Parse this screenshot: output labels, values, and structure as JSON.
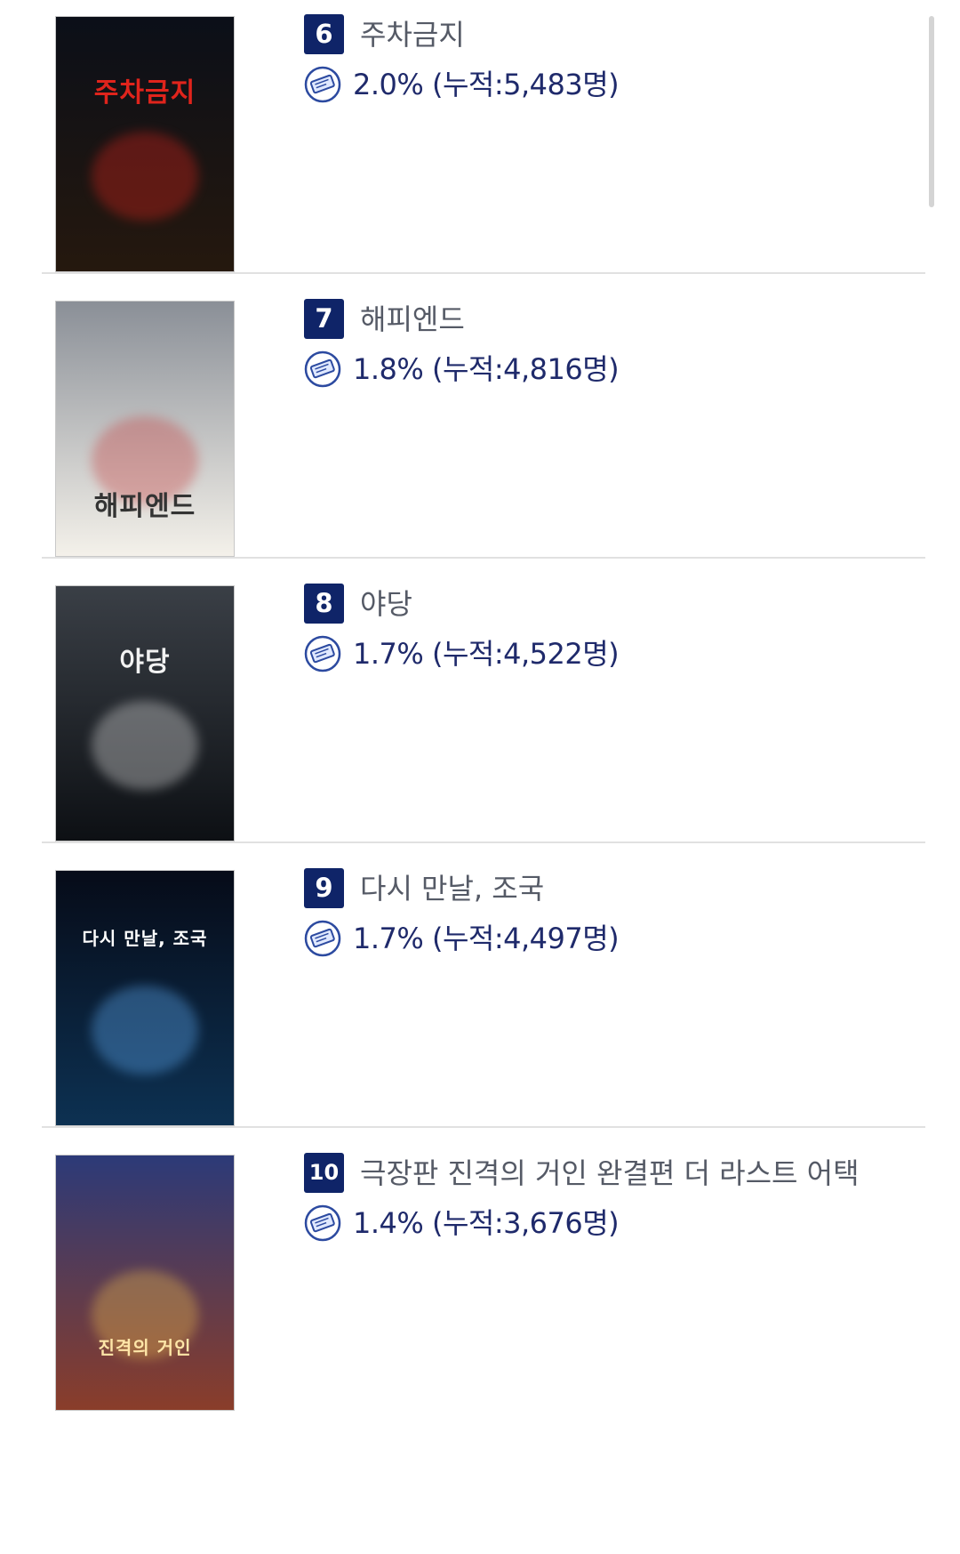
{
  "colors": {
    "rank_badge": "#0f2468",
    "stat_text": "#1f2a6b",
    "title_text": "#555a66",
    "divider": "#e1e1e1"
  },
  "icons": {
    "ticket": "ticket-icon"
  },
  "movies": [
    {
      "rank": "6",
      "title": "주차금지",
      "stat": "2.0% (누적:5,483명)",
      "poster": {
        "label": "주차금지",
        "bg": [
          "#0b0f18",
          "#25180e"
        ],
        "accent": "#e0241c",
        "label_color": "#e0241c"
      }
    },
    {
      "rank": "7",
      "title": "해피엔드",
      "stat": "1.8% (누적:4,816명)",
      "poster": {
        "label": "해피엔드",
        "bg": [
          "#8a8f97",
          "#f4f1ea"
        ],
        "accent": "#c63b3b",
        "label_color": "#333333"
      }
    },
    {
      "rank": "8",
      "title": "야당",
      "stat": "1.7% (누적:4,522명)",
      "poster": {
        "label": "야당",
        "bg": [
          "#3a3f46",
          "#0d1014"
        ],
        "accent": "#e9e9e9",
        "label_color": "#f2f2f2"
      }
    },
    {
      "rank": "9",
      "title": "다시 만날, 조국",
      "stat": "1.7% (누적:4,497명)",
      "poster": {
        "label": "다시 만날, 조국",
        "bg": [
          "#060b18",
          "#0d3152"
        ],
        "accent": "#64b4ff",
        "label_color": "#ffffff"
      }
    },
    {
      "rank": "10",
      "title": "극장판 진격의 거인 완결편 더 라스트 어택",
      "stat": "1.4% (누적:3,676명)",
      "poster": {
        "label": "진격의 거인",
        "bg": [
          "#2c3a78",
          "#8a3d2a"
        ],
        "accent": "#f2c14e",
        "label_color": "#ffe6a8"
      }
    }
  ]
}
